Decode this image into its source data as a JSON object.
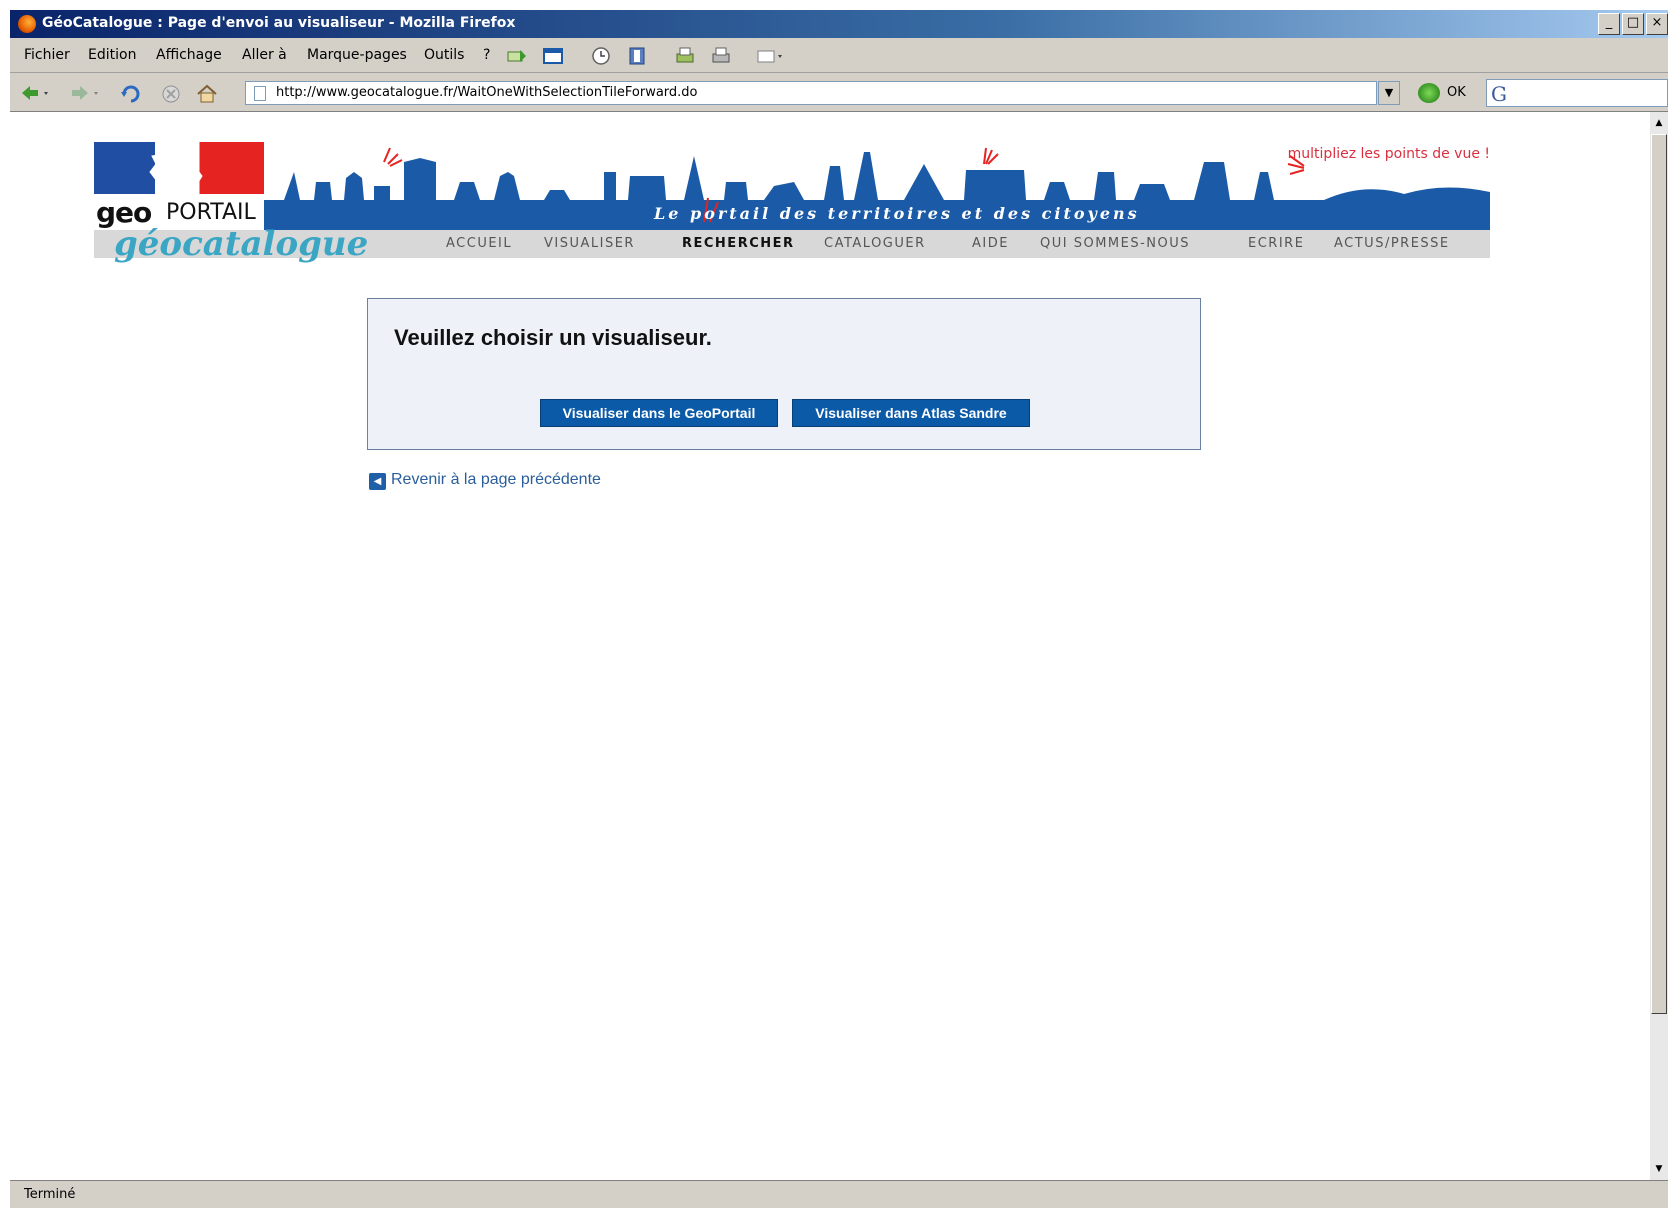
{
  "window": {
    "title": "GéoCatalogue : Page d'envoi au visualiseur - Mozilla Firefox",
    "controls": [
      "_",
      "□",
      "×"
    ]
  },
  "menubar": {
    "items": [
      {
        "label": "Fichier"
      },
      {
        "label": "Edition"
      },
      {
        "label": "Affichage"
      },
      {
        "label": "Aller à"
      },
      {
        "label": "Marque-pages"
      },
      {
        "label": "Outils"
      },
      {
        "label": "?"
      }
    ]
  },
  "navbar": {
    "url": "http://www.geocatalogue.fr/WaitOneWithSelectionTileForward.do",
    "go_label": "OK",
    "search_engine": "G"
  },
  "banner": {
    "slogan": "multipliez les points de vue !",
    "tagline": "Le portail des territoires et des citoyens",
    "logo_geo": "geo",
    "logo_portail": "PORTAIL",
    "brand": "géocatalogue",
    "colors": {
      "blue": "#1b5aa6",
      "red": "#e52421",
      "brand_cyan": "#3aa6c4"
    },
    "nav": [
      "ACCUEIL",
      "VISUALISER",
      "RECHERCHER",
      "CATALOGUER",
      "AIDE",
      "QUI SOMMES-NOUS",
      "ECRIRE",
      "ACTUS/PRESSE"
    ],
    "nav_active": "RECHERCHER"
  },
  "main": {
    "prompt": "Veuillez choisir un visualiseur.",
    "button_geoportail": "Visualiser dans le GeoPortail",
    "button_sandre": "Visualiser dans Atlas Sandre",
    "back_link": "Revenir à la page précédente"
  },
  "statusbar": {
    "text": "Terminé"
  }
}
